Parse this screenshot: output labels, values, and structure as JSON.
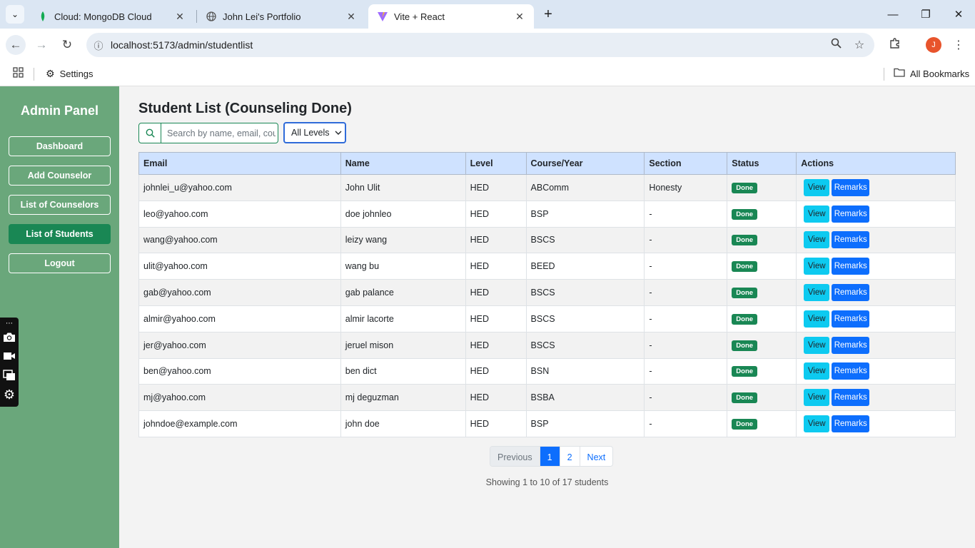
{
  "browser": {
    "tabs": [
      {
        "title": "Cloud: MongoDB Cloud",
        "active": false
      },
      {
        "title": "John Lei's Portfolio",
        "active": false
      },
      {
        "title": "Vite + React",
        "active": true
      }
    ],
    "url": "localhost:5173/admin/studentlist",
    "profile_initial": "J",
    "bookmarks": {
      "settings": "Settings",
      "all_bookmarks": "All Bookmarks"
    }
  },
  "sidebar": {
    "title": "Admin Panel",
    "items": [
      {
        "label": "Dashboard",
        "active": false
      },
      {
        "label": "Add Counselor",
        "active": false
      },
      {
        "label": "List of Counselors",
        "active": false
      },
      {
        "label": "List of Students",
        "active": true
      },
      {
        "label": "Logout",
        "active": false
      }
    ]
  },
  "main": {
    "title": "Student List (Counseling Done)",
    "search_placeholder": "Search by name, email, course...",
    "level_filter": "All Levels",
    "columns": [
      "Email",
      "Name",
      "Level",
      "Course/Year",
      "Section",
      "Status",
      "Actions"
    ],
    "rows": [
      {
        "email": "johnlei_u@yahoo.com",
        "name": "John Ulit",
        "level": "HED",
        "course": "ABComm",
        "section": "Honesty",
        "status": "Done"
      },
      {
        "email": "leo@yahoo.com",
        "name": "doe johnleo",
        "level": "HED",
        "course": "BSP",
        "section": "-",
        "status": "Done"
      },
      {
        "email": "wang@yahoo.com",
        "name": "leizy wang",
        "level": "HED",
        "course": "BSCS",
        "section": "-",
        "status": "Done"
      },
      {
        "email": "ulit@yahoo.com",
        "name": "wang bu",
        "level": "HED",
        "course": "BEED",
        "section": "-",
        "status": "Done"
      },
      {
        "email": "gab@yahoo.com",
        "name": "gab palance",
        "level": "HED",
        "course": "BSCS",
        "section": "-",
        "status": "Done"
      },
      {
        "email": "almir@yahoo.com",
        "name": "almir lacorte",
        "level": "HED",
        "course": "BSCS",
        "section": "-",
        "status": "Done"
      },
      {
        "email": "jer@yahoo.com",
        "name": "jeruel mison",
        "level": "HED",
        "course": "BSCS",
        "section": "-",
        "status": "Done"
      },
      {
        "email": "ben@yahoo.com",
        "name": "ben dict",
        "level": "HED",
        "course": "BSN",
        "section": "-",
        "status": "Done"
      },
      {
        "email": "mj@yahoo.com",
        "name": "mj deguzman",
        "level": "HED",
        "course": "BSBA",
        "section": "-",
        "status": "Done"
      },
      {
        "email": "johndoe@example.com",
        "name": "john doe",
        "level": "HED",
        "course": "BSP",
        "section": "-",
        "status": "Done"
      }
    ],
    "actions": {
      "view": "View",
      "remarks": "Remarks"
    },
    "pagination": {
      "previous": "Previous",
      "pages": [
        "1",
        "2"
      ],
      "current": "1",
      "next": "Next"
    },
    "showing_text": "Showing 1 to 10 of 17 students"
  },
  "colors": {
    "sidebar": "#6aa77b",
    "accent_green": "#198754",
    "primary": "#0d6efd",
    "info": "#0dcaf0",
    "table_header": "#cfe2ff"
  }
}
